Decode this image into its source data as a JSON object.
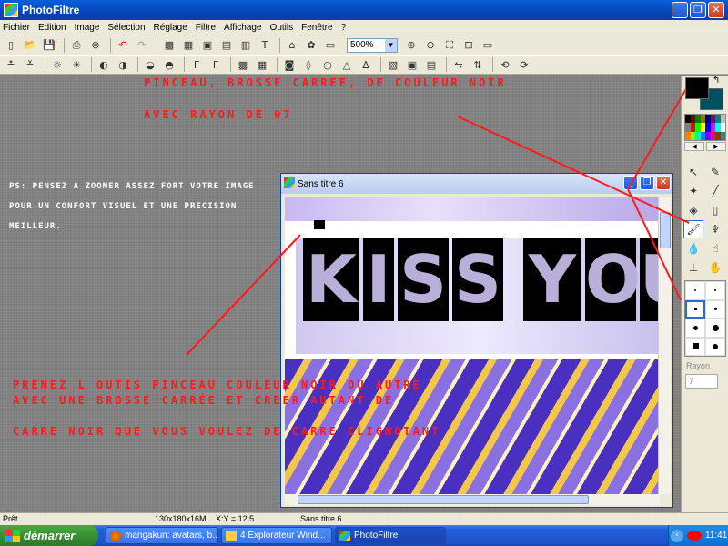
{
  "window": {
    "title": "PhotoFiltre"
  },
  "menu": [
    "Fichier",
    "Edition",
    "Image",
    "Sélection",
    "Réglage",
    "Filtre",
    "Affichage",
    "Outils",
    "Fenêtre",
    "?"
  ],
  "toolbar": {
    "zoom": "500%"
  },
  "overlay": {
    "line1": "Pinceau, brosse carree, de couleur noir",
    "line2": "avec rayon de 07",
    "ps1": "PS: Pensez a zoomer assez fort votre image",
    "ps2": "pour un confort visuel et une precision",
    "ps3": "meilleur.",
    "bottom1": "Prenez l outis pinceau couleur noir ou autre",
    "bottom2": "avec une brosse carrée et creer autant de",
    "bottom3": "carre noir que vous voulez de carre clignotant"
  },
  "image_window": {
    "title": "Sans titre 6",
    "letters": [
      "K",
      "I",
      "S",
      "S",
      "Y",
      "O",
      "U"
    ]
  },
  "tool_panel": {
    "rayon_label": "Rayon",
    "rayon_value": "7"
  },
  "status": {
    "ready": "Prêt",
    "size": "130x180x16M",
    "coords": "X:Y = 12:5",
    "doc": "Sans titre 6"
  },
  "taskbar": {
    "start": "démarrer",
    "items": [
      "mangakun: avatars, b...",
      "4 Explorateur Wind...",
      "PhotoFiltre"
    ],
    "clock": "11:41"
  },
  "colors": {
    "foreground": "#000000",
    "background": "#005060",
    "annotation": "#ff1a1a"
  }
}
